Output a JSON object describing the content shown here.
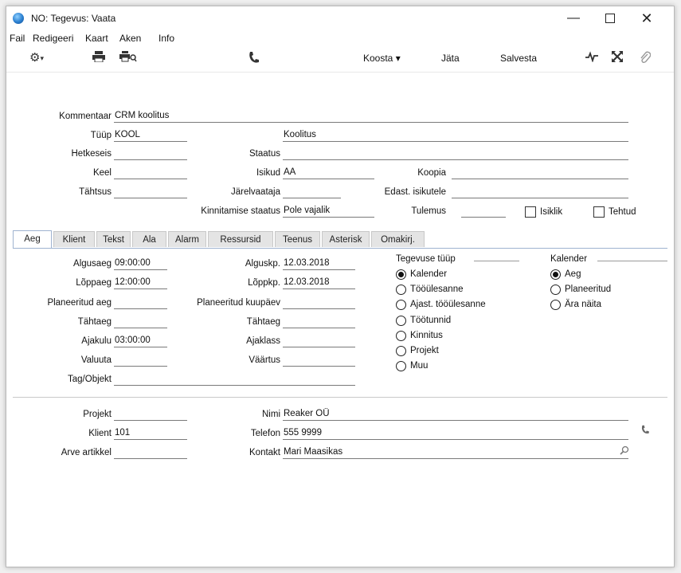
{
  "window": {
    "title": "NO: Tegevus: Vaata",
    "min_glyph": "—",
    "close_glyph": "✕"
  },
  "menu": [
    "Fail",
    "Redigeeri",
    "Kaart",
    "Aken",
    "Info"
  ],
  "toolbar": {
    "koosta": "Koosta ▾",
    "jata": "Jäta",
    "salvesta": "Salvesta"
  },
  "form": {
    "kommentaar": {
      "label": "Kommentaar",
      "value": "CRM koolitus"
    },
    "tuup": {
      "label": "Tüüp",
      "value": "KOOL",
      "description": "Koolitus"
    },
    "hetkeseis": {
      "label": "Hetkeseis",
      "value": ""
    },
    "staatus": {
      "label": "Staatus",
      "value": ""
    },
    "keel": {
      "label": "Keel",
      "value": ""
    },
    "isikud": {
      "label": "Isikud",
      "value": "AA"
    },
    "koopia": {
      "label": "Koopia",
      "value": ""
    },
    "tahtsus": {
      "label": "Tähtsus",
      "value": ""
    },
    "jarelvaataja": {
      "label": "Järelvaataja",
      "value": ""
    },
    "edast": {
      "label": "Edast. isikutele",
      "value": ""
    },
    "kinnitamise_staatus": {
      "label": "Kinnitamise staatus",
      "value": "Pole vajalik"
    },
    "tulemus": {
      "label": "Tulemus",
      "value": ""
    },
    "isiklik": {
      "label": "Isiklik",
      "checked": false
    },
    "tehtud": {
      "label": "Tehtud",
      "checked": false
    }
  },
  "tabs": [
    "Aeg",
    "Klient",
    "Tekst",
    "Ala",
    "Alarm",
    "Ressursid",
    "Teenus",
    "Asterisk",
    "Omakirj."
  ],
  "active_tab": "Aeg",
  "aeg": {
    "algusaeg": {
      "label": "Algusaeg",
      "value": "09:00:00"
    },
    "loppaeg": {
      "label": "Lõppaeg",
      "value": "12:00:00"
    },
    "planeeritud_aeg": {
      "label": "Planeeritud aeg",
      "value": ""
    },
    "tahtaeg": {
      "label": "Tähtaeg",
      "value": ""
    },
    "ajakulu": {
      "label": "Ajakulu",
      "value": "03:00:00"
    },
    "valuuta": {
      "label": "Valuuta",
      "value": ""
    },
    "tag_objekt": {
      "label": "Tag/Objekt",
      "value": ""
    },
    "alguskp": {
      "label": "Alguskp.",
      "value": "12.03.2018"
    },
    "loppkp": {
      "label": "Lõppkp.",
      "value": "12.03.2018"
    },
    "planeeritud_kuupaev": {
      "label": "Planeeritud kuupäev",
      "value": ""
    },
    "tahtaeg2": {
      "label": "Tähtaeg",
      "value": ""
    },
    "ajaklass": {
      "label": "Ajaklass",
      "value": ""
    },
    "vaartus": {
      "label": "Väärtus",
      "value": ""
    }
  },
  "tegevuse_tuup": {
    "title": "Tegevuse tüüp",
    "options": [
      "Kalender",
      "Tööülesanne",
      "Ajast. tööülesanne",
      "Töötunnid",
      "Kinnitus",
      "Projekt",
      "Muu"
    ],
    "selected": "Kalender"
  },
  "kalender": {
    "title": "Kalender",
    "options": [
      "Aeg",
      "Planeeritud",
      "Ära näita"
    ],
    "selected": "Aeg"
  },
  "bottom": {
    "projekt": {
      "label": "Projekt",
      "value": ""
    },
    "klient": {
      "label": "Klient",
      "value": "101"
    },
    "arve_artikkel": {
      "label": "Arve artikkel",
      "value": ""
    },
    "nimi": {
      "label": "Nimi",
      "value": "Reaker OÜ"
    },
    "telefon": {
      "label": "Telefon",
      "value": "555 9999"
    },
    "kontakt": {
      "label": "Kontakt",
      "value": "Mari Maasikas"
    }
  },
  "icons": {
    "gear": "gear-icon",
    "print": "printer-icon",
    "print_preview": "print-preview-icon",
    "phone": "phone-icon",
    "activity": "activity-icon",
    "expand": "expand-icon",
    "attach": "paperclip-icon",
    "search": "search-icon"
  }
}
